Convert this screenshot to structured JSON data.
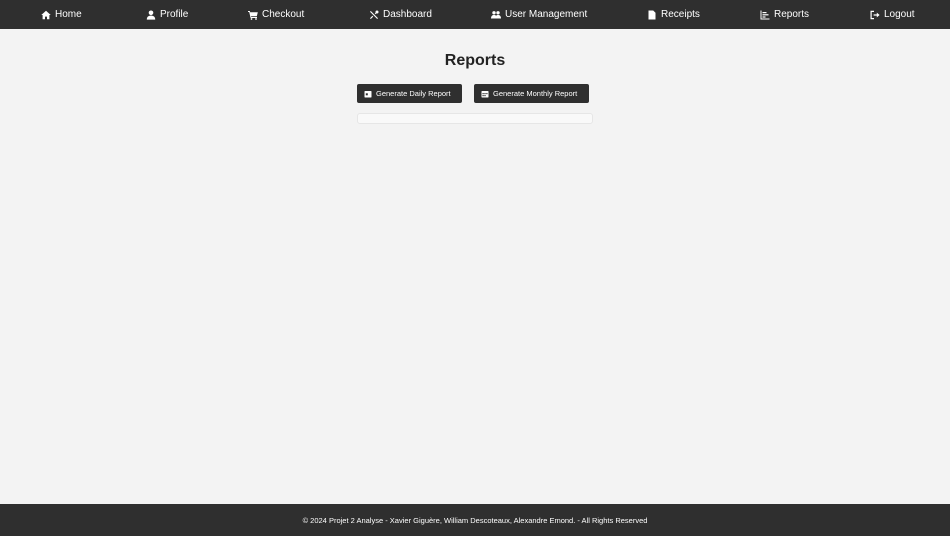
{
  "nav": {
    "items": [
      {
        "label": "Home",
        "icon": "home-icon"
      },
      {
        "label": "Profile",
        "icon": "user-icon"
      },
      {
        "label": "Checkout",
        "icon": "cart-icon"
      },
      {
        "label": "Dashboard",
        "icon": "tools-icon"
      },
      {
        "label": "User Management",
        "icon": "users-icon"
      },
      {
        "label": "Receipts",
        "icon": "file-icon"
      },
      {
        "label": "Reports",
        "icon": "chart-icon"
      },
      {
        "label": "Logout",
        "icon": "logout-icon"
      }
    ]
  },
  "main": {
    "title": "Reports",
    "daily_button": "Generate Daily Report",
    "monthly_button": "Generate Monthly Report"
  },
  "footer": {
    "text": "© 2024 Projet 2 Analyse - Xavier Giguère, William Descoteaux, Alexandre Emond. - All Rights Reserved"
  },
  "colors": {
    "navbar": "#2f2f2f",
    "background": "#f3f3f3",
    "button": "#2f2f2f"
  }
}
